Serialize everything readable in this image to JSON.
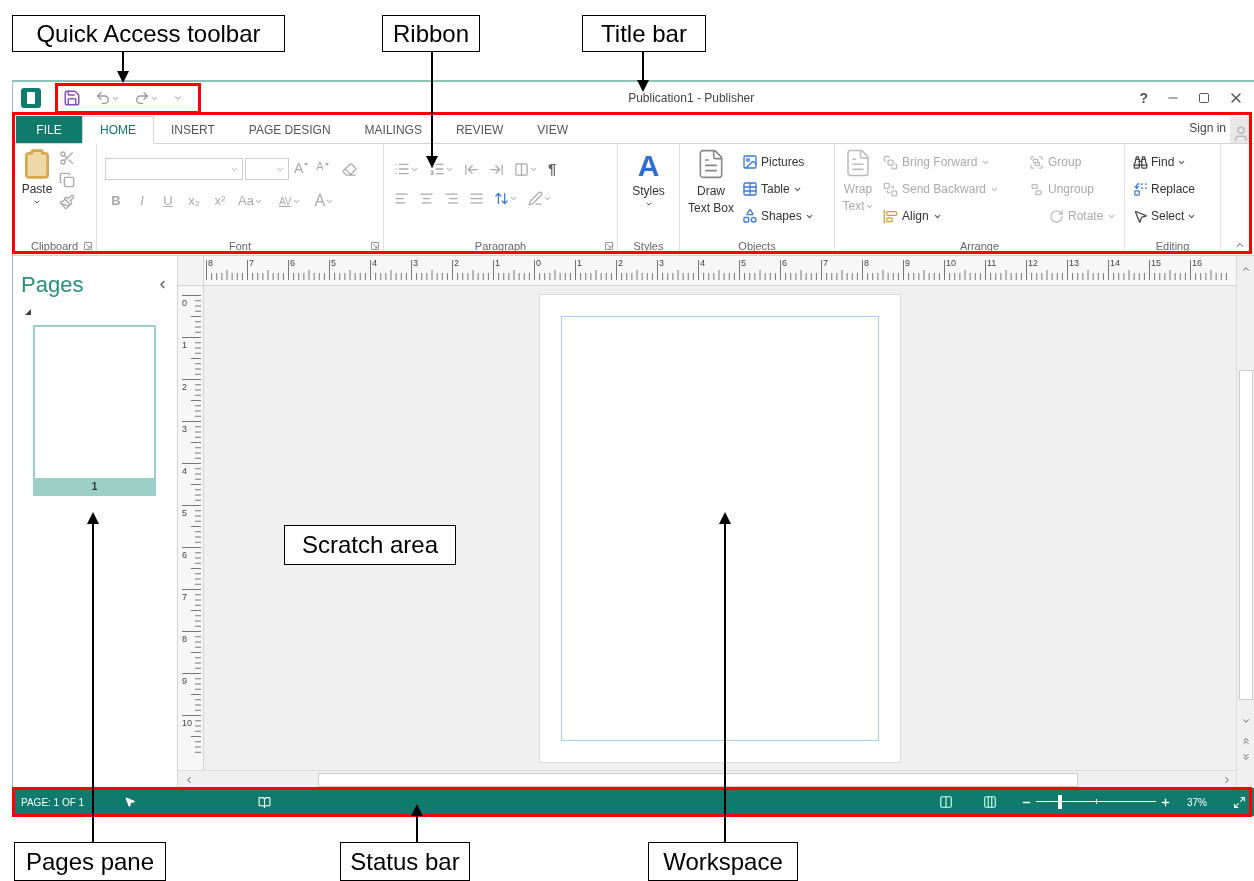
{
  "callouts": [
    {
      "label": "Quick Access toolbar"
    },
    {
      "label": "Ribbon"
    },
    {
      "label": "Title bar"
    },
    {
      "label": "Scratch area"
    },
    {
      "label": "Pages pane"
    },
    {
      "label": "Status bar"
    },
    {
      "label": "Workspace"
    }
  ],
  "title_bar": {
    "title": "Publication1 - Publisher",
    "help": "?"
  },
  "tabs": [
    {
      "label": "FILE",
      "kind": "file",
      "selected": false
    },
    {
      "label": "HOME",
      "kind": "tab",
      "selected": true
    },
    {
      "label": "INSERT",
      "kind": "tab",
      "selected": false
    },
    {
      "label": "PAGE DESIGN",
      "kind": "tab",
      "selected": false
    },
    {
      "label": "MAILINGS",
      "kind": "tab",
      "selected": false
    },
    {
      "label": "REVIEW",
      "kind": "tab",
      "selected": false
    },
    {
      "label": "VIEW",
      "kind": "tab",
      "selected": false
    }
  ],
  "sign_in": "Sign in",
  "ribbon": {
    "clipboard": {
      "label": "Clipboard",
      "launcher": true,
      "paste": "Paste"
    },
    "font": {
      "label": "Font",
      "launcher": true,
      "grow": "A",
      "shrink": "A",
      "format": [
        "B",
        "I",
        "U",
        "x₂",
        "x²"
      ],
      "case": "Aa",
      "spacing": "AV",
      "font_color_letter": "A"
    },
    "paragraph": {
      "label": "Paragraph",
      "launcher": true,
      "marks": "¶"
    },
    "styles": {
      "label": "Styles",
      "glyph": "A",
      "button": "Styles"
    },
    "objects": {
      "label": "Objects",
      "draw": [
        "Draw",
        "Text Box"
      ],
      "items": [
        {
          "label": "Pictures",
          "dropdown": false
        },
        {
          "label": "Table",
          "dropdown": true
        },
        {
          "label": "Shapes",
          "dropdown": true
        }
      ]
    },
    "arrange": {
      "label": "Arrange",
      "wrap": {
        "lines": [
          "Wrap",
          "Text"
        ],
        "disabled": true
      },
      "column_1": [
        {
          "label": "Bring Forward",
          "disabled": true,
          "dropdown": true
        },
        {
          "label": "Send Backward",
          "disabled": true,
          "dropdown": true
        },
        {
          "label": "Align",
          "disabled": false,
          "dropdown": true
        }
      ],
      "column_2": [
        {
          "label": "Group",
          "disabled": true,
          "dropdown": false
        },
        {
          "label": "Ungroup",
          "disabled": true,
          "dropdown": false
        },
        {
          "label": "Rotate",
          "disabled": true,
          "dropdown": true
        }
      ]
    },
    "editing": {
      "label": "Editing",
      "items": [
        {
          "label": "Find",
          "dropdown": true
        },
        {
          "label": "Replace",
          "dropdown": false
        },
        {
          "label": "Select",
          "dropdown": true
        }
      ]
    }
  },
  "pages_pane": {
    "title": "Pages",
    "pages": [
      {
        "number": "1",
        "selected": true
      }
    ]
  },
  "rulers": {
    "horizontal": [
      "8",
      "7",
      "6",
      "5",
      "4",
      "3",
      "2",
      "1",
      "0",
      "1",
      "2",
      "3",
      "4",
      "5",
      "6",
      "7",
      "8",
      "9",
      "10",
      "11",
      "12",
      "13",
      "14",
      "15",
      "16"
    ],
    "vertical": [
      "0",
      "1",
      "2",
      "3",
      "4",
      "5",
      "6",
      "7",
      "8",
      "9",
      "10"
    ]
  },
  "status_bar": {
    "page": "PAGE: 1 OF 1",
    "zoom": "37%",
    "zoom_slider": {
      "level": 0.2
    }
  }
}
